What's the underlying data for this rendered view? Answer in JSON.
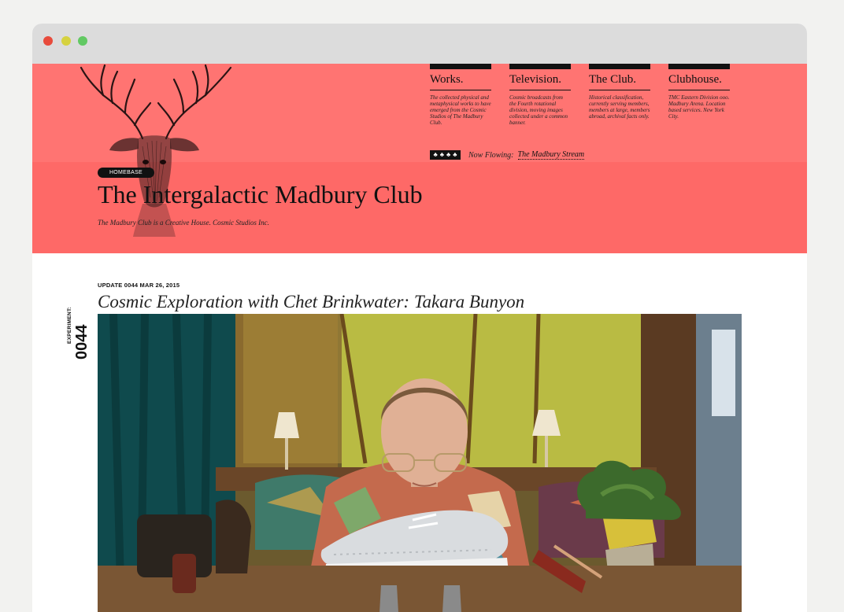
{
  "colors": {
    "header_top": "#ff7472",
    "header_band": "#fe6967",
    "dot_red": "#e84b3c",
    "dot_yellow": "#d6d240",
    "dot_green": "#62c963"
  },
  "nav": {
    "items": [
      {
        "title": "Works.",
        "desc": "The collected physical and metaphysical works to have emerged from the Cosmic Studios of The Madbury Club."
      },
      {
        "title": "Television.",
        "desc": "Cosmic broadcasts from the Fourth rotational division, moving images collected under a common banner."
      },
      {
        "title": "The Club.",
        "desc": "Historical classification, currently serving members, members at large, members abroad, archival facts only."
      },
      {
        "title": "Clubhouse.",
        "desc": "TMC Eastern Division ooo. Madbury Arena. Location based services. New York City."
      }
    ]
  },
  "stream": {
    "icon": "club-suits-icon",
    "label": "Now Flowing:",
    "link": "The Madbury Stream"
  },
  "header": {
    "badge": "HOMEBASE",
    "title": "The Intergalactic Madbury Club",
    "tagline": "The Madbury Club is a Creative House. Cosmic Studios Inc."
  },
  "post": {
    "update": "UPDATE 0044  MAR 26, 2015",
    "title": "Cosmic Exploration with Chet Brinkwater: Takara Bunyon",
    "experiment_label": "EXPERIMENT:",
    "experiment_number": "0044",
    "image": "man-smelling-sneaker-photo"
  }
}
